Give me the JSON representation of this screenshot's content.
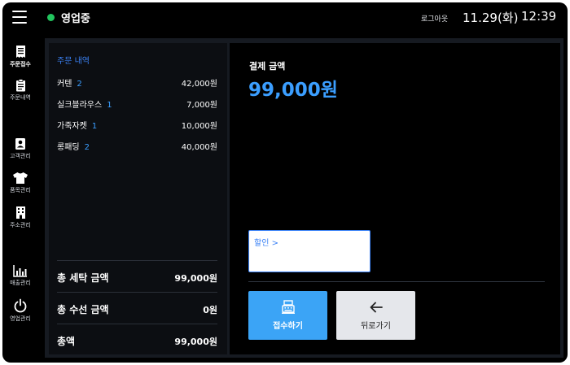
{
  "header": {
    "status": "영업중",
    "status_color": "#22c55e",
    "logout": "로그아웃",
    "date": "11.29(화)",
    "time": "12:39"
  },
  "sidebar": {
    "items": [
      {
        "label": "주문접수",
        "icon": "receipt-icon",
        "active": true
      },
      {
        "label": "주문내역",
        "icon": "clipboard-icon"
      },
      {
        "label": "고객관리",
        "icon": "contact-card-icon"
      },
      {
        "label": "품목관리",
        "icon": "shirt-icon"
      },
      {
        "label": "주소관리",
        "icon": "building-icon"
      },
      {
        "label": "매출관리",
        "icon": "bar-chart-icon"
      },
      {
        "label": "영업관리",
        "icon": "power-icon"
      }
    ]
  },
  "order": {
    "title": "주문 내역",
    "items": [
      {
        "name": "커텐",
        "qty": "2",
        "price": "42,000원"
      },
      {
        "name": "실크블라우스",
        "qty": "1",
        "price": "7,000원"
      },
      {
        "name": "가죽자켓",
        "qty": "1",
        "price": "10,000원"
      },
      {
        "name": "롱패딩",
        "qty": "2",
        "price": "40,000원"
      }
    ],
    "summary": [
      {
        "label": "총 세탁 금액",
        "value": "99,000원"
      },
      {
        "label": "총 수선 금액",
        "value": "0원"
      },
      {
        "label": "총액",
        "value": "99,000원"
      }
    ]
  },
  "payment": {
    "label": "결제 금액",
    "amount": "99,000원",
    "discount": "할인 >",
    "accept_label": "접수하기",
    "back_label": "뒤로가기"
  },
  "colors": {
    "accent": "#3b9eff",
    "accept_button": "#3ba4f6",
    "back_button": "#e5e7eb"
  }
}
